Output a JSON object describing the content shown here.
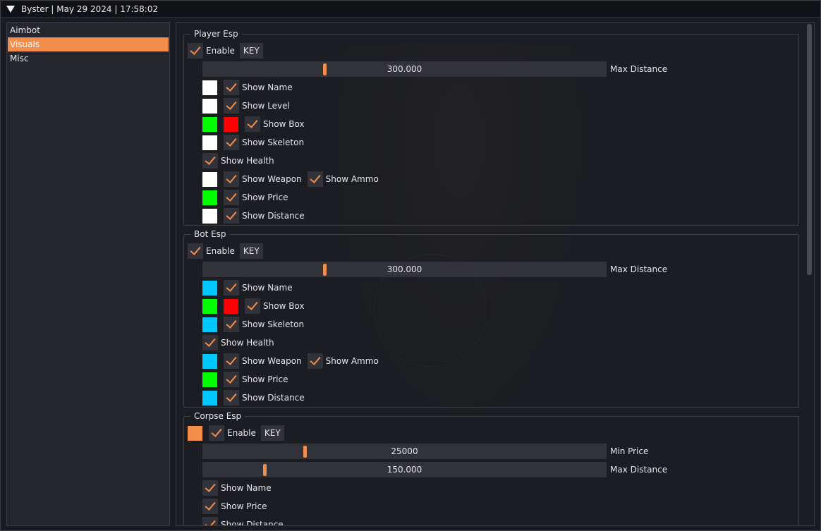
{
  "window": {
    "title": "Byster | May 29 2024 | 17:58:02"
  },
  "colors": {
    "accent": "#f28d4b",
    "white": "#ffffff",
    "green": "#00ff00",
    "red": "#ff0000",
    "cyan": "#00c8ff"
  },
  "sidebar": {
    "items": [
      {
        "label": "Aimbot",
        "active": false
      },
      {
        "label": "Visuals",
        "active": true
      },
      {
        "label": "Misc",
        "active": false
      }
    ]
  },
  "player_esp": {
    "title": "Player Esp",
    "enable_label": "Enable",
    "enable_checked": true,
    "key_label": "KEY",
    "max_distance": {
      "value": "300.000",
      "label": "Max Distance",
      "fraction": 0.3
    },
    "show_name": "Show Name",
    "show_level": "Show Level",
    "show_box": "Show Box",
    "show_skeleton": "Show Skeleton",
    "show_health": "Show Health",
    "show_weapon": "Show Weapon",
    "show_ammo": "Show Ammo",
    "show_price": "Show Price",
    "show_distance": "Show Distance"
  },
  "bot_esp": {
    "title": "Bot Esp",
    "enable_label": "Enable",
    "enable_checked": true,
    "key_label": "KEY",
    "max_distance": {
      "value": "300.000",
      "label": "Max Distance",
      "fraction": 0.3
    },
    "show_name": "Show Name",
    "show_box": "Show Box",
    "show_skeleton": "Show Skeleton",
    "show_health": "Show Health",
    "show_weapon": "Show Weapon",
    "show_ammo": "Show Ammo",
    "show_price": "Show Price",
    "show_distance": "Show Distance"
  },
  "corpse_esp": {
    "title": "Corpse Esp",
    "enable_label": "Enable",
    "enable_checked": true,
    "key_label": "KEY",
    "min_price": {
      "value": "25000",
      "label": "Min Price",
      "fraction": 0.25
    },
    "max_distance": {
      "value": "150.000",
      "label": "Max Distance",
      "fraction": 0.15
    },
    "show_name": "Show Name",
    "show_price": "Show Price",
    "show_distance": "Show Distance"
  }
}
